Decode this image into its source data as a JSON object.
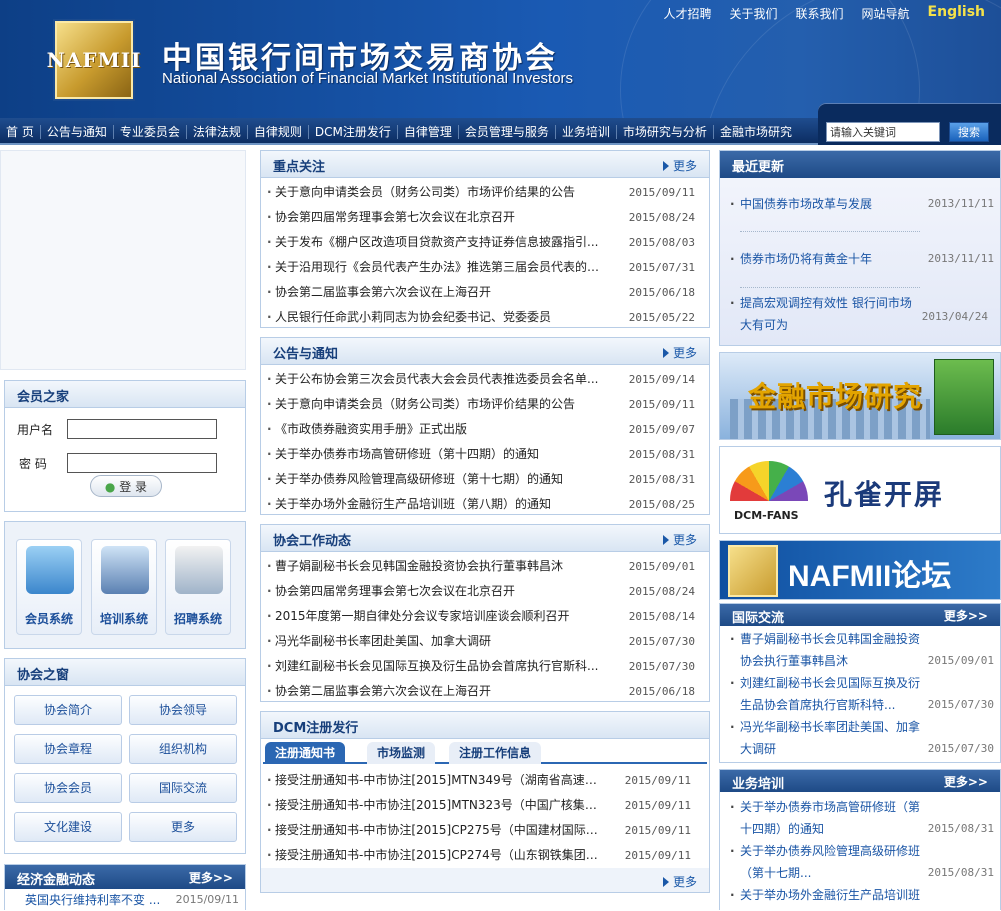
{
  "header": {
    "logo_text": "NAFMII",
    "title_cn": "中国银行间市场交易商协会",
    "title_en": "National Association of Financial Market Institutional Investors",
    "links": [
      "人才招聘",
      "关于我们",
      "联系我们",
      "网站导航"
    ],
    "english": "English"
  },
  "nav": {
    "items": [
      "首 页",
      "公告与通知",
      "专业委员会",
      "法律法规",
      "自律规则",
      "DCM注册发行",
      "自律管理",
      "会员管理与服务",
      "业务培训",
      "市场研究与分析",
      "金融市场研究"
    ]
  },
  "search": {
    "placeholder": "请输入关键词",
    "button": "搜索"
  },
  "member": {
    "title": "会员之家",
    "username_label": "用户名",
    "password_label": "密 码",
    "login": "登 录"
  },
  "systems": [
    {
      "label": "会员系统",
      "icon": "folder-icon"
    },
    {
      "label": "培训系统",
      "icon": "gear-icon"
    },
    {
      "label": "招聘系统",
      "icon": "recruit-icon"
    }
  ],
  "window": {
    "title": "协会之窗",
    "buttons": [
      "协会简介",
      "协会领导",
      "协会章程",
      "组织机构",
      "协会会员",
      "国际交流",
      "文化建设",
      "更多"
    ]
  },
  "econ": {
    "title": "经济金融动态",
    "more": "更多>>",
    "items": [
      {
        "title": "英国央行维持利率不变 ...",
        "date": "2015/09/11"
      }
    ]
  },
  "focus": {
    "title": "重点关注",
    "more": "更多",
    "items": [
      {
        "title": "关于意向申请类会员（财务公司类）市场评价结果的公告",
        "date": "2015/09/11"
      },
      {
        "title": "协会第四届常务理事会第七次会议在北京召开",
        "date": "2015/08/24"
      },
      {
        "title": "关于发布《棚户区改造项目贷款资产支持证券信息披露指引...",
        "date": "2015/08/03"
      },
      {
        "title": "关于沿用现行《会员代表产生办法》推选第三届会员代表的公告",
        "date": "2015/07/31"
      },
      {
        "title": "协会第二届监事会第六次会议在上海召开",
        "date": "2015/06/18"
      },
      {
        "title": "人民银行任命武小莉同志为协会纪委书记、党委委员",
        "date": "2015/05/22"
      }
    ]
  },
  "notice": {
    "title": "公告与通知",
    "more": "更多",
    "items": [
      {
        "title": "关于公布协会第三次会员代表大会会员代表推选委员会名单...",
        "date": "2015/09/14"
      },
      {
        "title": "关于意向申请类会员（财务公司类）市场评价结果的公告",
        "date": "2015/09/11"
      },
      {
        "title": "《市政债券融资实用手册》正式出版",
        "date": "2015/09/07"
      },
      {
        "title": "关于举办债券市场高管研修班（第十四期）的通知",
        "date": "2015/08/31"
      },
      {
        "title": "关于举办债券风险管理高级研修班（第十七期）的通知",
        "date": "2015/08/31"
      },
      {
        "title": "关于举办场外金融衍生产品培训班（第八期）的通知",
        "date": "2015/08/25"
      }
    ]
  },
  "work": {
    "title": "协会工作动态",
    "more": "更多",
    "items": [
      {
        "title": "曹子娟副秘书长会见韩国金融投资协会执行董事韩昌沐",
        "date": "2015/09/01"
      },
      {
        "title": "协会第四届常务理事会第七次会议在北京召开",
        "date": "2015/08/24"
      },
      {
        "title": "2015年度第一期自律处分会议专家培训座谈会顺利召开",
        "date": "2015/08/14"
      },
      {
        "title": "冯光华副秘书长率团赴美国、加拿大调研",
        "date": "2015/07/30"
      },
      {
        "title": "刘建红副秘书长会见国际互换及衍生品协会首席执行官斯科...",
        "date": "2015/07/30"
      },
      {
        "title": "协会第二届监事会第六次会议在上海召开",
        "date": "2015/06/18"
      }
    ]
  },
  "dcm": {
    "title": "DCM注册发行",
    "tabs": [
      "注册通知书",
      "市场监测",
      "注册工作信息"
    ],
    "more": "更多",
    "items": [
      {
        "title": "接受注册通知书-中市协注[2015]MTN349号（湖南省高速公路...",
        "date": "2015/09/11"
      },
      {
        "title": "接受注册通知书-中市协注[2015]MTN323号（中国广核集团有...",
        "date": "2015/09/11"
      },
      {
        "title": "接受注册通知书-中市协注[2015]CP275号（中国建材国际工...",
        "date": "2015/09/11"
      },
      {
        "title": "接受注册通知书-中市协注[2015]CP274号（山东钢铁集团有...",
        "date": "2015/09/11"
      }
    ]
  },
  "latest": {
    "title": "最近更新",
    "items": [
      {
        "title": "中国债券市场改革与发展",
        "date": "2013/11/11"
      },
      {
        "title": "债券市场仍将有黄金十年",
        "date": "2013/11/11"
      },
      {
        "title": "提高宏观调控有效性 银行间市场大有可为",
        "date": "2013/04/24"
      }
    ]
  },
  "banners": {
    "research": "金融市场研究",
    "dcm_fans": "DCM-FANS",
    "peacock": "孔雀开屏",
    "forum": "NAFMII论坛"
  },
  "intl": {
    "title": "国际交流",
    "more": "更多>>",
    "items": [
      {
        "title": "曹子娟副秘书长会见韩国金融投资协会执行董事韩昌沐",
        "date": "2015/09/01"
      },
      {
        "title": "刘建红副秘书长会见国际互换及衍生品协会首席执行官斯科特...",
        "date": "2015/07/30"
      },
      {
        "title": "冯光华副秘书长率团赴美国、加拿大调研",
        "date": "2015/07/30"
      }
    ]
  },
  "training": {
    "title": "业务培训",
    "more": "更多>>",
    "items": [
      {
        "title": "关于举办债券市场高管研修班（第十四期）的通知",
        "date": "2015/08/31"
      },
      {
        "title": "关于举办债券风险管理高级研修班（第十七期...",
        "date": "2015/08/31"
      },
      {
        "title": "关于举办场外金融衍生产品培训班（第八期）的通知",
        "date": ""
      }
    ]
  }
}
